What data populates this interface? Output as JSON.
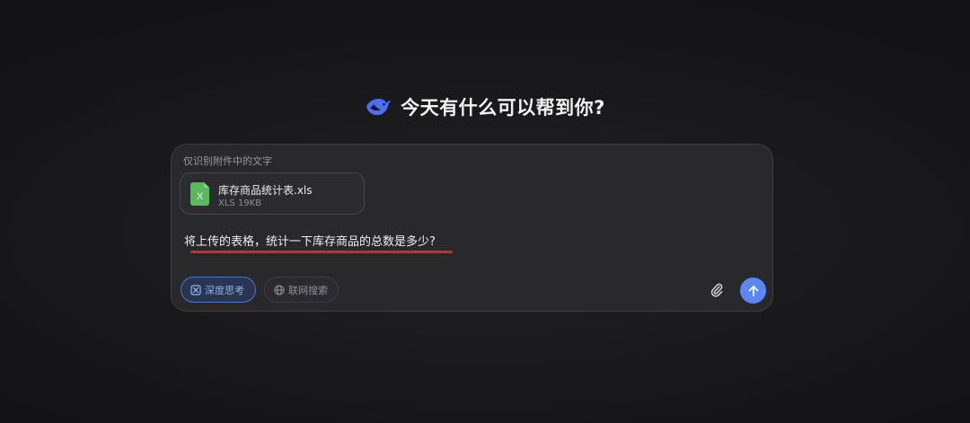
{
  "header": {
    "title": "今天有什么可以帮到你?",
    "logo_icon": "whale-logo-icon"
  },
  "composer": {
    "mode_note": "仅识别附件中的文字",
    "attachment": {
      "name": "库存商品统计表.xls",
      "meta": "XLS 19KB",
      "icon": "excel-file-icon",
      "icon_color": "#5cb85c"
    },
    "message": "将上传的表格，统计一下库存商品的总数是多少?",
    "annotation_color": "#d8262b",
    "toolbar": {
      "deep_think_label": "深度思考",
      "deep_think_icon": "atom-icon",
      "web_search_label": "联网搜索",
      "web_search_icon": "globe-icon",
      "attach_icon": "paperclip-icon",
      "send_icon": "arrow-up-icon"
    }
  },
  "colors": {
    "accent": "#5b87f5",
    "background": "#19191b",
    "panel": "#29292c"
  }
}
